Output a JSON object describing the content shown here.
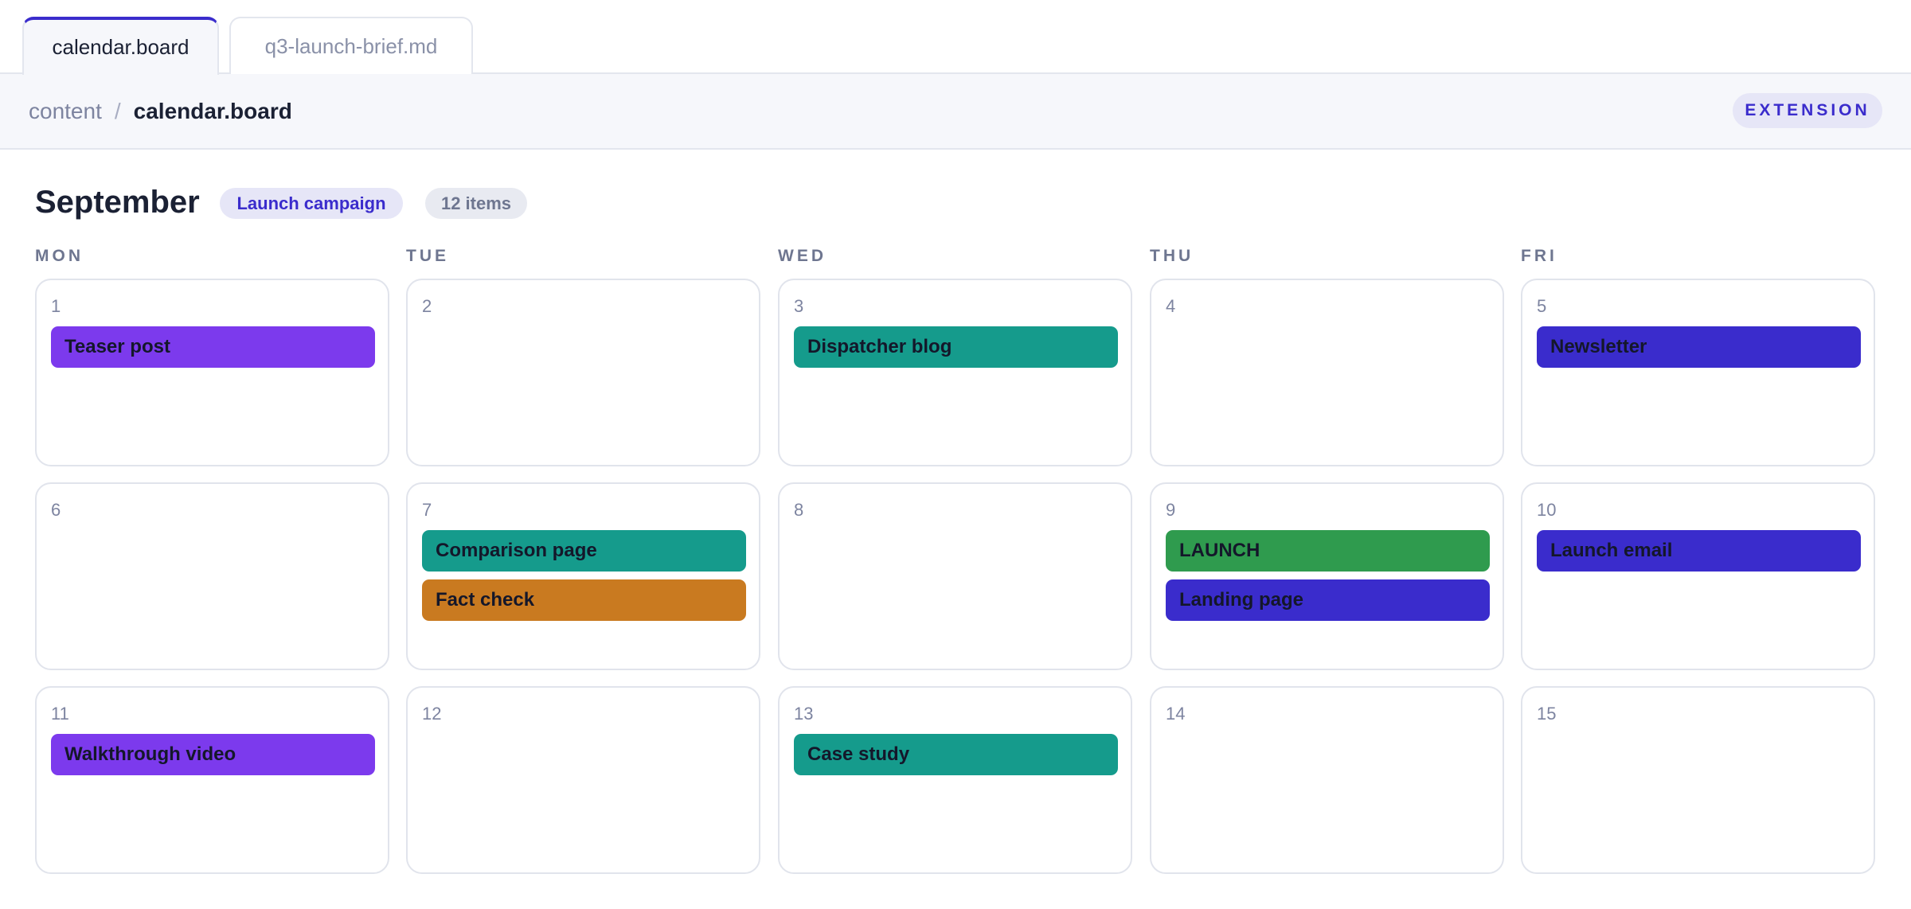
{
  "tabs": [
    {
      "label": "calendar.board",
      "active": true
    },
    {
      "label": "q3-launch-brief.md",
      "active": false
    }
  ],
  "breadcrumb": {
    "root": "content",
    "separator": "/",
    "current": "calendar.board"
  },
  "badge": "EXTENSION",
  "calendar": {
    "month": "September",
    "campaign": "Launch campaign",
    "item_count": "12 items",
    "weekdays": [
      "MON",
      "TUE",
      "WED",
      "THU",
      "FRI"
    ],
    "days": [
      {
        "num": "1",
        "events": [
          {
            "label": "Teaser post",
            "color": "#7c3aed"
          }
        ]
      },
      {
        "num": "2",
        "events": []
      },
      {
        "num": "3",
        "events": [
          {
            "label": "Dispatcher blog",
            "color": "#159b8c"
          }
        ]
      },
      {
        "num": "4",
        "events": []
      },
      {
        "num": "5",
        "events": [
          {
            "label": "Newsletter",
            "color": "#3a2ccc"
          }
        ]
      },
      {
        "num": "6",
        "events": []
      },
      {
        "num": "7",
        "events": [
          {
            "label": "Comparison page",
            "color": "#159b8c"
          },
          {
            "label": "Fact check",
            "color": "#c97a20"
          }
        ]
      },
      {
        "num": "8",
        "events": []
      },
      {
        "num": "9",
        "events": [
          {
            "label": "LAUNCH",
            "color": "#2f9b4e"
          },
          {
            "label": "Landing page",
            "color": "#3a2ccc"
          }
        ]
      },
      {
        "num": "10",
        "events": [
          {
            "label": "Launch email",
            "color": "#3a2ccc"
          }
        ]
      },
      {
        "num": "11",
        "events": [
          {
            "label": "Walkthrough video",
            "color": "#7c3aed"
          }
        ]
      },
      {
        "num": "12",
        "events": []
      },
      {
        "num": "13",
        "events": [
          {
            "label": "Case study",
            "color": "#159b8c"
          }
        ]
      },
      {
        "num": "14",
        "events": []
      },
      {
        "num": "15",
        "events": []
      }
    ]
  }
}
